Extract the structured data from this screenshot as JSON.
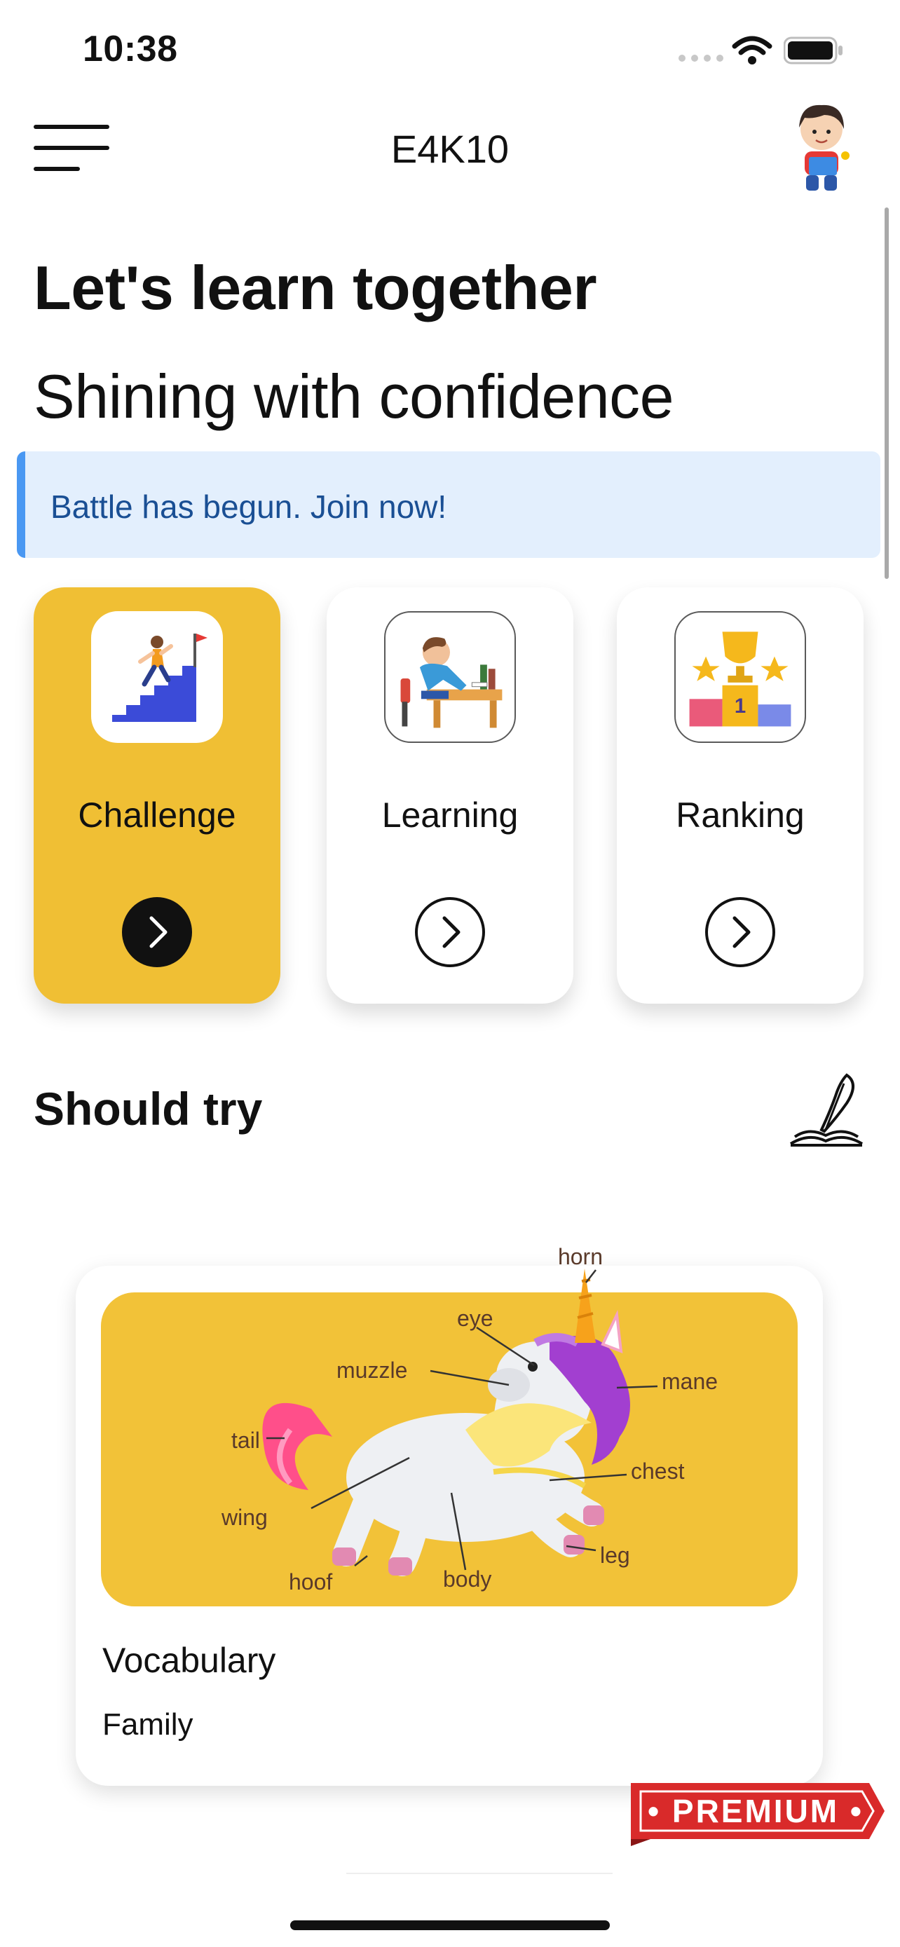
{
  "status_bar": {
    "time": "10:38"
  },
  "header": {
    "title": "E4K10"
  },
  "hero": {
    "title": "Let's learn together",
    "subtitle": "Shining with confidence"
  },
  "banner": {
    "text": "Battle has begun. Join now!"
  },
  "cards": [
    {
      "label": "Challenge",
      "icon": "stairs-climb-icon",
      "active": true
    },
    {
      "label": "Learning",
      "icon": "studying-boy-icon",
      "active": false
    },
    {
      "label": "Ranking",
      "icon": "trophy-podium-icon",
      "active": false
    }
  ],
  "should_try": {
    "title": "Should try",
    "item": {
      "title": "Vocabulary",
      "subtitle": "Family",
      "image_labels": [
        "horn",
        "eye",
        "muzzle",
        "mane",
        "tail",
        "chest",
        "wing",
        "leg",
        "hoof",
        "body"
      ]
    }
  },
  "premium": {
    "label": "• PREMIUM •"
  },
  "colors": {
    "accent": "#f0bf34",
    "banner_bg": "#e3effd",
    "banner_bar": "#4a98f2",
    "banner_text": "#1a4f94",
    "premium": "#d92a2a"
  }
}
